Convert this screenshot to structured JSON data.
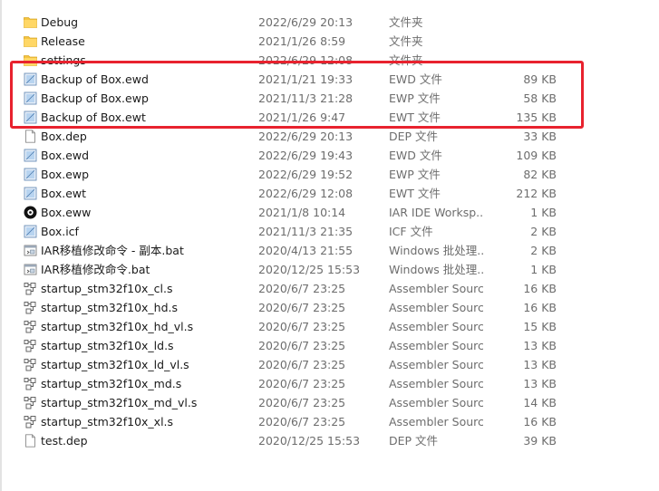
{
  "colors": {
    "highlight": "#e8222e",
    "folder": "#f5c542",
    "meta_text": "#6d6d6d"
  },
  "files": [
    {
      "name": "Debug",
      "date": "2022/6/29 20:13",
      "type": "文件夹",
      "size": "",
      "icon": "folder-icon"
    },
    {
      "name": "Release",
      "date": "2021/1/26 8:59",
      "type": "文件夹",
      "size": "",
      "icon": "folder-icon"
    },
    {
      "name": "settings",
      "date": "2022/6/29 12:08",
      "type": "文件夹",
      "size": "",
      "icon": "folder-icon"
    },
    {
      "name": "Backup of Box.ewd",
      "date": "2021/1/21 19:33",
      "type": "EWD 文件",
      "size": "89 KB",
      "icon": "iar-workbench-file-icon"
    },
    {
      "name": "Backup of Box.ewp",
      "date": "2021/11/3 21:28",
      "type": "EWP 文件",
      "size": "58 KB",
      "icon": "iar-workbench-file-icon"
    },
    {
      "name": "Backup of Box.ewt",
      "date": "2021/1/26 9:47",
      "type": "EWT 文件",
      "size": "135 KB",
      "icon": "iar-workbench-file-icon"
    },
    {
      "name": "Box.dep",
      "date": "2022/6/29 20:13",
      "type": "DEP 文件",
      "size": "33 KB",
      "icon": "blank-file-icon"
    },
    {
      "name": "Box.ewd",
      "date": "2022/6/29 19:43",
      "type": "EWD 文件",
      "size": "109 KB",
      "icon": "iar-workbench-file-icon"
    },
    {
      "name": "Box.ewp",
      "date": "2022/6/29 19:52",
      "type": "EWP 文件",
      "size": "82 KB",
      "icon": "iar-workbench-file-icon"
    },
    {
      "name": "Box.ewt",
      "date": "2022/6/29 12:08",
      "type": "EWT 文件",
      "size": "212 KB",
      "icon": "iar-workbench-file-icon"
    },
    {
      "name": "Box.eww",
      "date": "2021/1/8 10:14",
      "type": "IAR IDE Worksp...",
      "size": "1 KB",
      "icon": "iar-ide-workspace-icon"
    },
    {
      "name": "Box.icf",
      "date": "2021/11/3 21:35",
      "type": "ICF 文件",
      "size": "2 KB",
      "icon": "iar-workbench-file-icon"
    },
    {
      "name": "IAR移植修改命令 - 副本.bat",
      "date": "2020/4/13 21:55",
      "type": "Windows 批处理...",
      "size": "2 KB",
      "icon": "batch-file-icon"
    },
    {
      "name": "IAR移植修改命令.bat",
      "date": "2020/12/25 15:53",
      "type": "Windows 批处理...",
      "size": "1 KB",
      "icon": "batch-file-icon"
    },
    {
      "name": "startup_stm32f10x_cl.s",
      "date": "2020/6/7 23:25",
      "type": "Assembler Source",
      "size": "16 KB",
      "icon": "assembler-source-icon"
    },
    {
      "name": "startup_stm32f10x_hd.s",
      "date": "2020/6/7 23:25",
      "type": "Assembler Source",
      "size": "16 KB",
      "icon": "assembler-source-icon"
    },
    {
      "name": "startup_stm32f10x_hd_vl.s",
      "date": "2020/6/7 23:25",
      "type": "Assembler Source",
      "size": "15 KB",
      "icon": "assembler-source-icon"
    },
    {
      "name": "startup_stm32f10x_ld.s",
      "date": "2020/6/7 23:25",
      "type": "Assembler Source",
      "size": "13 KB",
      "icon": "assembler-source-icon"
    },
    {
      "name": "startup_stm32f10x_ld_vl.s",
      "date": "2020/6/7 23:25",
      "type": "Assembler Source",
      "size": "13 KB",
      "icon": "assembler-source-icon"
    },
    {
      "name": "startup_stm32f10x_md.s",
      "date": "2020/6/7 23:25",
      "type": "Assembler Source",
      "size": "13 KB",
      "icon": "assembler-source-icon"
    },
    {
      "name": "startup_stm32f10x_md_vl.s",
      "date": "2020/6/7 23:25",
      "type": "Assembler Source",
      "size": "14 KB",
      "icon": "assembler-source-icon"
    },
    {
      "name": "startup_stm32f10x_xl.s",
      "date": "2020/6/7 23:25",
      "type": "Assembler Source",
      "size": "16 KB",
      "icon": "assembler-source-icon"
    },
    {
      "name": "test.dep",
      "date": "2020/12/25 15:53",
      "type": "DEP 文件",
      "size": "39 KB",
      "icon": "blank-file-icon"
    }
  ]
}
